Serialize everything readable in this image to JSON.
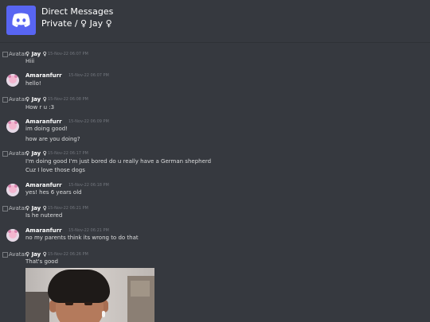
{
  "header": {
    "title": "Direct Messages",
    "subtitle": "Private / ♀ Jay ♀"
  },
  "broken_avatar_alt": "Avatar",
  "messages": [
    {
      "author": "♀ Jay ♀",
      "timestamp": "15-Nov-22 06:07 PM",
      "lines": [
        "Hiii"
      ]
    },
    {
      "author": "Amaranfurr",
      "timestamp": "15-Nov-22 06:07 PM",
      "lines": [
        "hello!"
      ]
    },
    {
      "author": "♀ Jay ♀",
      "timestamp": "15-Nov-22 06:08 PM",
      "lines": [
        "How r u :3"
      ]
    },
    {
      "author": "Amaranfurr",
      "timestamp": "15-Nov-22 06:09 PM",
      "lines": [
        "im doing good!",
        "how are you doing?"
      ]
    },
    {
      "author": "♀ Jay ♀",
      "timestamp": "15-Nov-22 06:17 PM",
      "lines": [
        "I'm doing good I'm just bored do u really have a German shepherd",
        "Cuz I love those dogs"
      ]
    },
    {
      "author": "Amaranfurr",
      "timestamp": "15-Nov-22 06:18 PM",
      "lines": [
        "yes! hes 6 years old"
      ]
    },
    {
      "author": "♀ Jay ♀",
      "timestamp": "15-Nov-22 06:21 PM",
      "lines": [
        "Is he nutered"
      ]
    },
    {
      "author": "Amaranfurr",
      "timestamp": "15-Nov-22 06:21 PM",
      "lines": [
        "no my parents think its wrong to do that"
      ]
    },
    {
      "author": "♀ Jay ♀",
      "timestamp": "15-Nov-22 06:26 PM",
      "lines": [
        "That's good"
      ]
    }
  ],
  "colors": {
    "background": "#36393f",
    "logo": "#5865f2",
    "timestamp": "#72767d"
  }
}
